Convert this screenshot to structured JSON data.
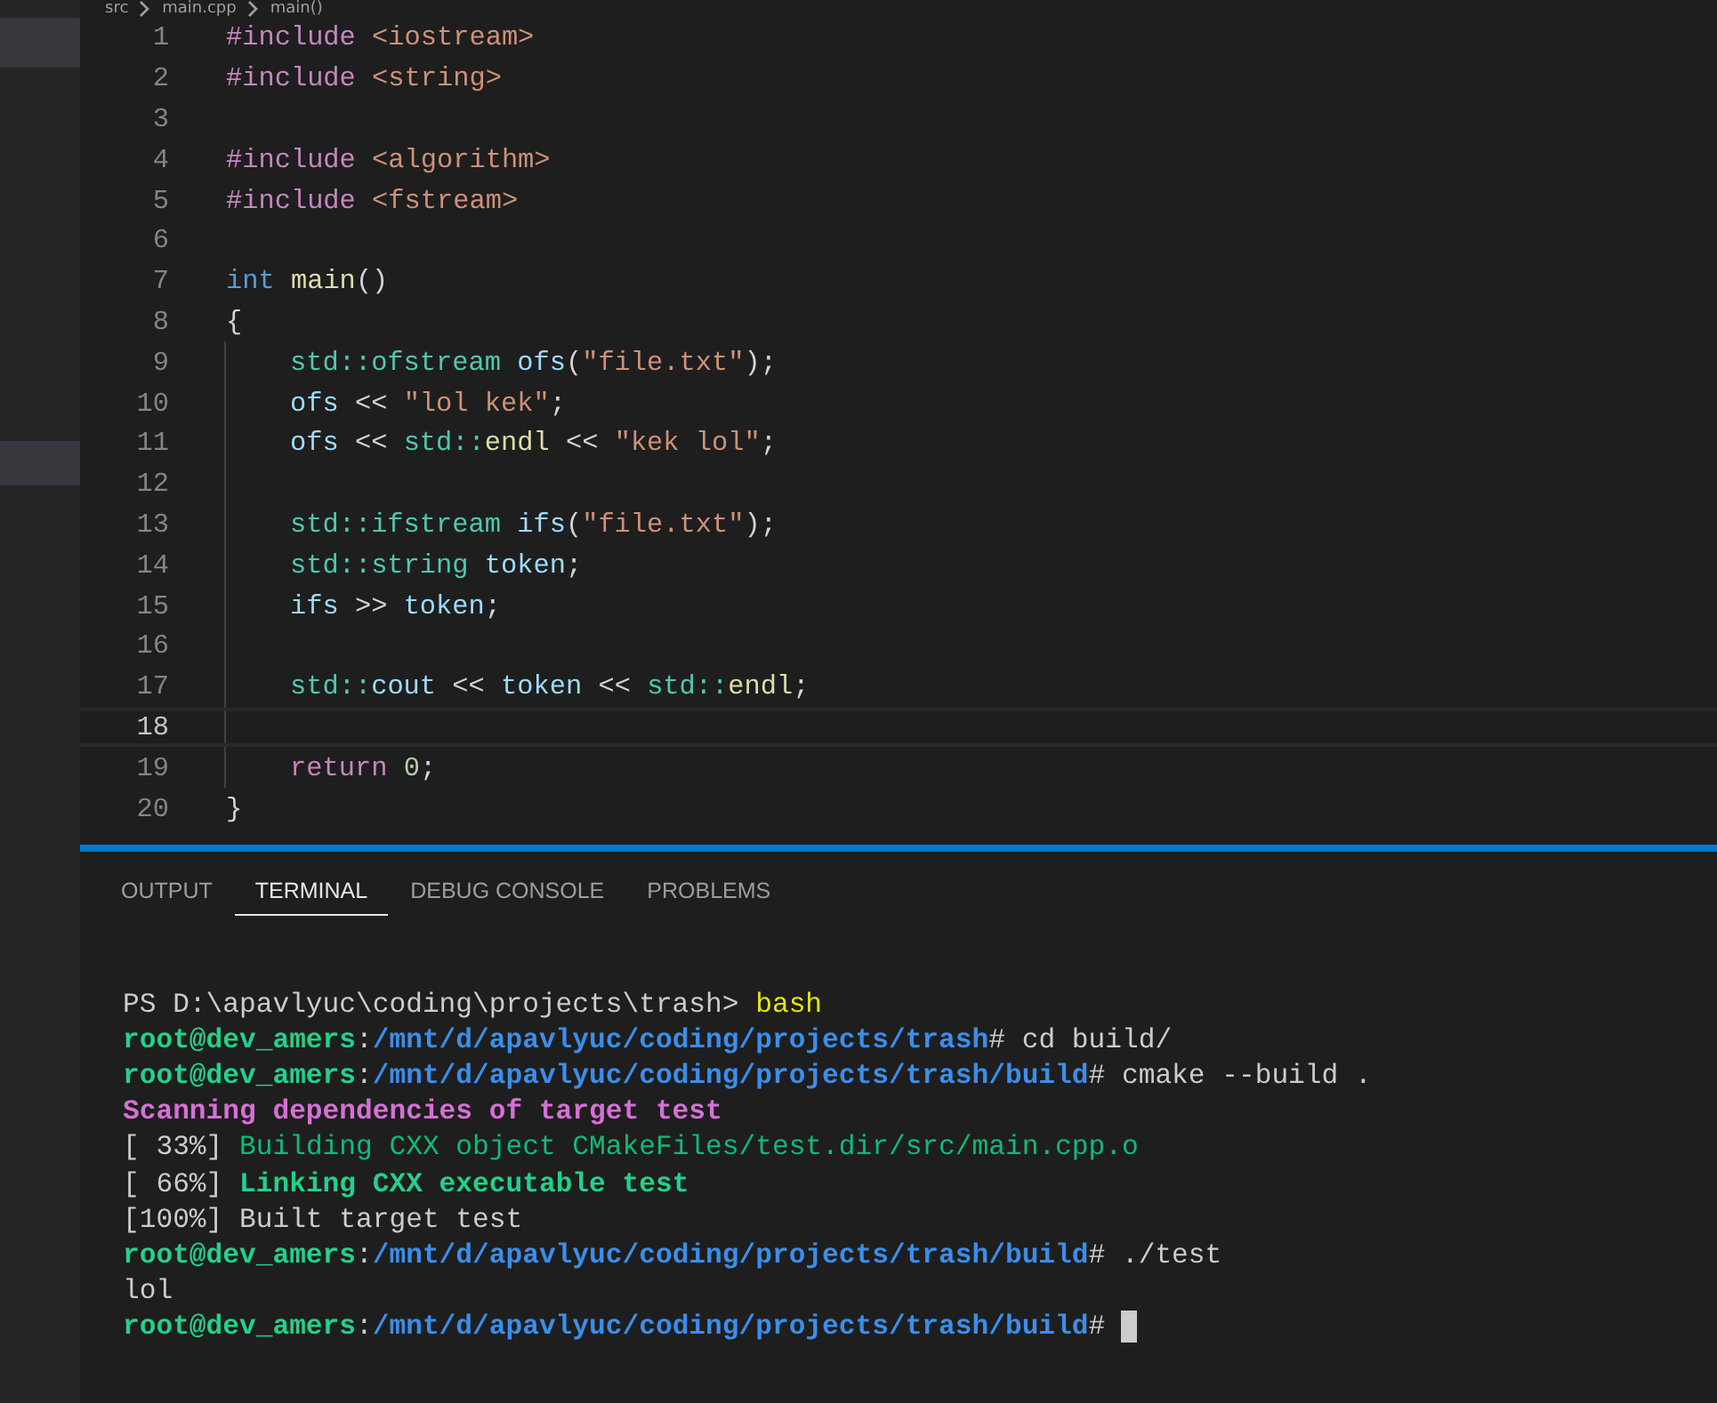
{
  "breadcrumb": [
    {
      "label": "src"
    },
    {
      "label": "main.cpp"
    },
    {
      "label": "main()"
    }
  ],
  "sidebar": {
    "items": [
      {
        "selected": true
      },
      {
        "selected": true
      }
    ]
  },
  "editor": {
    "lines": [
      {
        "number": "1",
        "current": false,
        "indented": false,
        "tokens": [
          {
            "kind": "keyword",
            "text": "#include "
          },
          {
            "kind": "string",
            "text": "<iostream>"
          }
        ]
      },
      {
        "number": "2",
        "current": false,
        "indented": false,
        "tokens": [
          {
            "kind": "keyword",
            "text": "#include "
          },
          {
            "kind": "string",
            "text": "<string>"
          }
        ]
      },
      {
        "number": "3",
        "current": false,
        "indented": false
      },
      {
        "number": "4",
        "current": false,
        "indented": false,
        "tokens": [
          {
            "kind": "keyword",
            "text": "#include "
          },
          {
            "kind": "string",
            "text": "<algorithm>"
          }
        ]
      },
      {
        "number": "5",
        "current": false,
        "indented": false,
        "tokens": [
          {
            "kind": "keyword",
            "text": "#include "
          },
          {
            "kind": "string",
            "text": "<fstream>"
          }
        ]
      },
      {
        "number": "6",
        "current": false,
        "indented": false
      },
      {
        "number": "7",
        "current": false,
        "indented": false,
        "tokens": [
          {
            "kind": "storage",
            "text": "int "
          },
          {
            "kind": "function",
            "text": "main"
          },
          {
            "kind": "plain",
            "text": "()"
          }
        ]
      },
      {
        "number": "8",
        "current": false,
        "indented": false,
        "tokens": [
          {
            "kind": "plain",
            "text": "{"
          }
        ]
      },
      {
        "number": "9",
        "current": false,
        "indented": true,
        "tokens": [
          {
            "kind": "type",
            "text": "std::ofstream "
          },
          {
            "kind": "variable",
            "text": "ofs"
          },
          {
            "kind": "plain",
            "text": "("
          },
          {
            "kind": "string",
            "text": "\"file.txt\""
          },
          {
            "kind": "plain",
            "text": ");"
          }
        ]
      },
      {
        "number": "10",
        "current": false,
        "indented": true,
        "tokens": [
          {
            "kind": "variable",
            "text": "ofs"
          },
          {
            "kind": "plain",
            "text": " << "
          },
          {
            "kind": "string",
            "text": "\"lol kek\""
          },
          {
            "kind": "plain",
            "text": ";"
          }
        ]
      },
      {
        "number": "11",
        "current": false,
        "indented": true,
        "tokens": [
          {
            "kind": "variable",
            "text": "ofs"
          },
          {
            "kind": "plain",
            "text": " << "
          },
          {
            "kind": "type",
            "text": "std::"
          },
          {
            "kind": "function",
            "text": "endl"
          },
          {
            "kind": "plain",
            "text": " << "
          },
          {
            "kind": "string",
            "text": "\"kek lol\""
          },
          {
            "kind": "plain",
            "text": ";"
          }
        ]
      },
      {
        "number": "12",
        "current": false,
        "indented": true
      },
      {
        "number": "13",
        "current": false,
        "indented": true,
        "tokens": [
          {
            "kind": "type",
            "text": "std::ifstream "
          },
          {
            "kind": "variable",
            "text": "ifs"
          },
          {
            "kind": "plain",
            "text": "("
          },
          {
            "kind": "string",
            "text": "\"file.txt\""
          },
          {
            "kind": "plain",
            "text": ");"
          }
        ]
      },
      {
        "number": "14",
        "current": false,
        "indented": true,
        "tokens": [
          {
            "kind": "type",
            "text": "std::string "
          },
          {
            "kind": "variable",
            "text": "token"
          },
          {
            "kind": "plain",
            "text": ";"
          }
        ]
      },
      {
        "number": "15",
        "current": false,
        "indented": true,
        "tokens": [
          {
            "kind": "variable",
            "text": "ifs"
          },
          {
            "kind": "plain",
            "text": " >> "
          },
          {
            "kind": "variable",
            "text": "token"
          },
          {
            "kind": "plain",
            "text": ";"
          }
        ]
      },
      {
        "number": "16",
        "current": false,
        "indented": true
      },
      {
        "number": "17",
        "current": false,
        "indented": true,
        "tokens": [
          {
            "kind": "type",
            "text": "std::"
          },
          {
            "kind": "variable",
            "text": "cout"
          },
          {
            "kind": "plain",
            "text": " << "
          },
          {
            "kind": "variable",
            "text": "token"
          },
          {
            "kind": "plain",
            "text": " << "
          },
          {
            "kind": "type",
            "text": "std::"
          },
          {
            "kind": "function",
            "text": "endl"
          },
          {
            "kind": "plain",
            "text": ";"
          }
        ]
      },
      {
        "number": "18",
        "current": true,
        "indented": true
      },
      {
        "number": "19",
        "current": false,
        "indented": true,
        "tokens": [
          {
            "kind": "keyword",
            "text": "return "
          },
          {
            "kind": "number",
            "text": "0"
          },
          {
            "kind": "plain",
            "text": ";"
          }
        ]
      },
      {
        "number": "20",
        "current": false,
        "indented": false,
        "tokens": [
          {
            "kind": "plain",
            "text": "}"
          }
        ]
      }
    ]
  },
  "panel": {
    "tabs": [
      {
        "label": "OUTPUT",
        "selected": false
      },
      {
        "label": "TERMINAL",
        "selected": true
      },
      {
        "label": "DEBUG CONSOLE",
        "selected": false
      },
      {
        "label": "PROBLEMS",
        "selected": false
      }
    ],
    "terminal": {
      "lines": [
        {
          "cursor": false,
          "segments": [
            {
              "kind": "plain",
              "text": "PS D:\\apavlyuc\\coding\\projects\\trash> "
            },
            {
              "kind": "command",
              "text": "bash"
            }
          ]
        },
        {
          "cursor": false,
          "segments": [
            {
              "kind": "user",
              "text": "root@dev_amers"
            },
            {
              "kind": "plain",
              "text": ":"
            },
            {
              "kind": "path",
              "text": "/mnt/d/apavlyuc/coding/projects/trash"
            },
            {
              "kind": "plain",
              "text": "# cd build/"
            }
          ]
        },
        {
          "cursor": false,
          "segments": [
            {
              "kind": "user",
              "text": "root@dev_amers"
            },
            {
              "kind": "plain",
              "text": ":"
            },
            {
              "kind": "path",
              "text": "/mnt/d/apavlyuc/coding/projects/trash/build"
            },
            {
              "kind": "plain",
              "text": "# cmake --build ."
            }
          ]
        },
        {
          "cursor": false,
          "segments": [
            {
              "kind": "magenta",
              "text": "Scanning dependencies of target test"
            }
          ]
        },
        {
          "cursor": false,
          "segments": [
            {
              "kind": "plain",
              "text": "[ 33%] "
            },
            {
              "kind": "green",
              "text": "Building CXX object CMakeFiles/test.dir/src/main.cpp.o"
            }
          ]
        },
        {
          "cursor": false,
          "segments": [
            {
              "kind": "plain",
              "text": "[ 66%] "
            },
            {
              "kind": "green-bold",
              "text": "Linking CXX executable test"
            }
          ]
        },
        {
          "cursor": false,
          "segments": [
            {
              "kind": "plain",
              "text": "[100%] Built target test"
            }
          ]
        },
        {
          "cursor": false,
          "segments": [
            {
              "kind": "user",
              "text": "root@dev_amers"
            },
            {
              "kind": "plain",
              "text": ":"
            },
            {
              "kind": "path",
              "text": "/mnt/d/apavlyuc/coding/projects/trash/build"
            },
            {
              "kind": "plain",
              "text": "# ./test"
            }
          ]
        },
        {
          "cursor": false,
          "segments": [
            {
              "kind": "plain",
              "text": "lol"
            }
          ]
        },
        {
          "cursor": true,
          "segments": [
            {
              "kind": "user",
              "text": "root@dev_amers"
            },
            {
              "kind": "plain",
              "text": ":"
            },
            {
              "kind": "path",
              "text": "/mnt/d/apavlyuc/coding/projects/trash/build"
            },
            {
              "kind": "plain",
              "text": "#"
            }
          ]
        }
      ]
    }
  }
}
